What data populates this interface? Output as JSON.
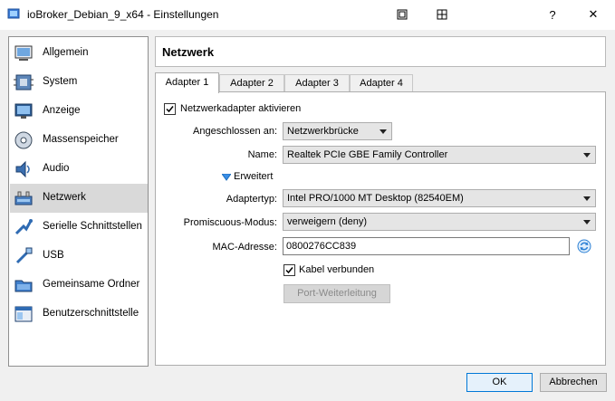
{
  "window": {
    "title": "ioBroker_Debian_9_x64 - Einstellungen",
    "controls": [
      "?",
      "✕"
    ]
  },
  "sidebar": {
    "items": [
      {
        "label": "Allgemein",
        "icon": "general-icon"
      },
      {
        "label": "System",
        "icon": "system-icon"
      },
      {
        "label": "Anzeige",
        "icon": "display-icon"
      },
      {
        "label": "Massenspeicher",
        "icon": "storage-icon"
      },
      {
        "label": "Audio",
        "icon": "audio-icon"
      },
      {
        "label": "Netzwerk",
        "icon": "network-icon",
        "selected": true
      },
      {
        "label": "Serielle Schnittstellen",
        "icon": "serial-icon"
      },
      {
        "label": "USB",
        "icon": "usb-icon"
      },
      {
        "label": "Gemeinsame Ordner",
        "icon": "shared-folder-icon"
      },
      {
        "label": "Benutzerschnittstelle",
        "icon": "user-interface-icon"
      }
    ]
  },
  "main": {
    "title": "Netzwerk",
    "tabs": [
      {
        "label": "Adapter 1",
        "active": true
      },
      {
        "label": "Adapter 2"
      },
      {
        "label": "Adapter 3"
      },
      {
        "label": "Adapter 4"
      }
    ],
    "enable_adapter": {
      "label": "Netzwerkadapter aktivieren",
      "checked": true
    },
    "attached_to": {
      "label": "Angeschlossen an:",
      "value": "Netzwerkbrücke"
    },
    "name": {
      "label": "Name:",
      "value": "Realtek PCIe GBE Family Controller"
    },
    "advanced": {
      "label": "Erweitert",
      "expanded": true
    },
    "adapter_type": {
      "label": "Adaptertyp:",
      "value": "Intel PRO/1000 MT Desktop (82540EM)"
    },
    "promiscuous": {
      "label": "Promiscuous-Modus:",
      "value": "verweigern (deny)"
    },
    "mac": {
      "label": "MAC-Adresse:",
      "value": "0800276CC839"
    },
    "cable": {
      "label": "Kabel verbunden",
      "checked": true
    },
    "port_forwarding": {
      "label": "Port-Weiterleitung"
    }
  },
  "footer": {
    "ok": "OK",
    "cancel": "Abbrechen"
  },
  "colors": {
    "accent": "#0078d7",
    "selected_nav": "#d9d9d9",
    "refresh_icon": "#2a7fd4"
  }
}
